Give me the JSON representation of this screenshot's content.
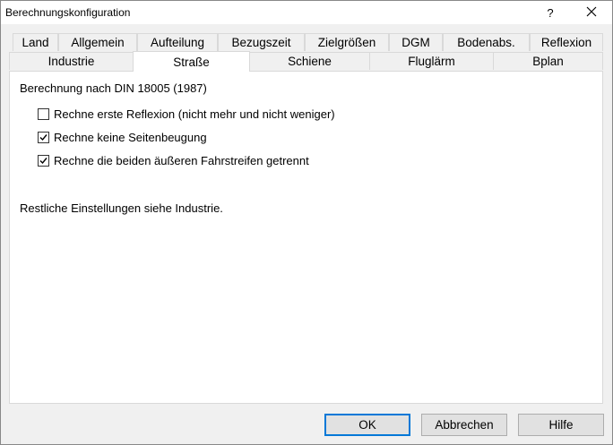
{
  "window": {
    "title": "Berechnungskonfiguration",
    "help_label": "?",
    "close_icon": "close-icon"
  },
  "tabs": {
    "row1": [
      "Land",
      "Allgemein",
      "Aufteilung",
      "Bezugszeit",
      "Zielgrößen",
      "DGM",
      "Bodenabs.",
      "Reflexion"
    ],
    "row2": [
      "Industrie",
      "Straße",
      "Schiene",
      "Fluglärm",
      "Bplan"
    ],
    "active": "Straße"
  },
  "panel": {
    "heading": "Berechnung nach DIN 18005 (1987)",
    "options": [
      {
        "label": "Rechne erste Reflexion (nicht mehr und nicht weniger)",
        "checked": false
      },
      {
        "label": "Rechne keine Seitenbeugung",
        "checked": true
      },
      {
        "label": "Rechne die beiden äußeren Fahrstreifen getrennt",
        "checked": true
      }
    ],
    "note": "Restliche Einstellungen siehe Industrie."
  },
  "buttons": {
    "ok": "OK",
    "cancel": "Abbrechen",
    "help": "Hilfe"
  },
  "colors": {
    "accent": "#0078d7",
    "background": "#f0f0f0"
  }
}
